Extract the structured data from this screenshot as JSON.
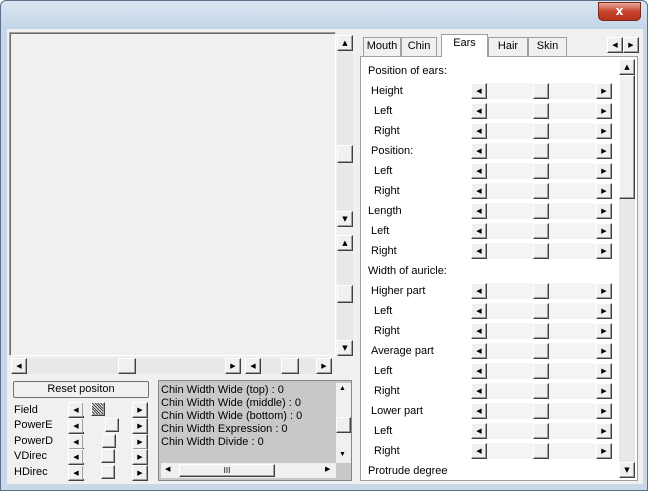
{
  "window": {
    "close_symbol": "x",
    "close_icon": "close-icon"
  },
  "left": {
    "reset_label": "Reset positon",
    "controls": [
      {
        "label": "Field",
        "thumb": "hatched"
      },
      {
        "label": "PowerE",
        "thumb": "normal"
      },
      {
        "label": "PowerD",
        "thumb": "normal"
      },
      {
        "label": "VDirec",
        "thumb": "normal"
      },
      {
        "label": "HDirec",
        "thumb": "normal"
      }
    ],
    "info_lines": [
      "Chin Width  Wide (top) : 0",
      "Chin Width  Wide (middle) : 0",
      "Chin Width  Wide (bottom) : 0",
      "Chin Width  Expression : 0",
      "Chin Width  Divide : 0"
    ],
    "hscroll_grip": "III"
  },
  "tabs": [
    {
      "label": "Mouth",
      "active": false
    },
    {
      "label": "Chin",
      "active": false
    },
    {
      "label": "Ears",
      "active": true
    },
    {
      "label": "Hair",
      "active": false
    },
    {
      "label": "Skin",
      "active": false
    }
  ],
  "arrows": {
    "left": "◀",
    "right": "▶",
    "up": "▲",
    "down": "▼"
  },
  "panel": {
    "rows": [
      {
        "label": "Position of ears:",
        "indent": 0,
        "slider": false
      },
      {
        "label": "Height",
        "indent": 1,
        "slider": true
      },
      {
        "label": "Left",
        "indent": 2,
        "slider": true
      },
      {
        "label": "Right",
        "indent": 2,
        "slider": true
      },
      {
        "label": "Position:",
        "indent": 1,
        "slider": true
      },
      {
        "label": "Left",
        "indent": 2,
        "slider": true
      },
      {
        "label": "Right",
        "indent": 2,
        "slider": true
      },
      {
        "label": "Length",
        "indent": 0,
        "slider": true
      },
      {
        "label": "Left",
        "indent": 1,
        "slider": true
      },
      {
        "label": "Right",
        "indent": 1,
        "slider": true
      },
      {
        "label": "Width of auricle:",
        "indent": 0,
        "slider": false
      },
      {
        "label": "Higher part",
        "indent": 1,
        "slider": true
      },
      {
        "label": "Left",
        "indent": 2,
        "slider": true
      },
      {
        "label": "Right",
        "indent": 2,
        "slider": true
      },
      {
        "label": "Average part",
        "indent": 1,
        "slider": true
      },
      {
        "label": "Left",
        "indent": 2,
        "slider": true
      },
      {
        "label": "Right",
        "indent": 2,
        "slider": true
      },
      {
        "label": "Lower part",
        "indent": 1,
        "slider": true
      },
      {
        "label": "Left",
        "indent": 2,
        "slider": true
      },
      {
        "label": "Right",
        "indent": 2,
        "slider": true
      },
      {
        "label": "Protrude degree",
        "indent": 0,
        "slider": false
      }
    ]
  }
}
